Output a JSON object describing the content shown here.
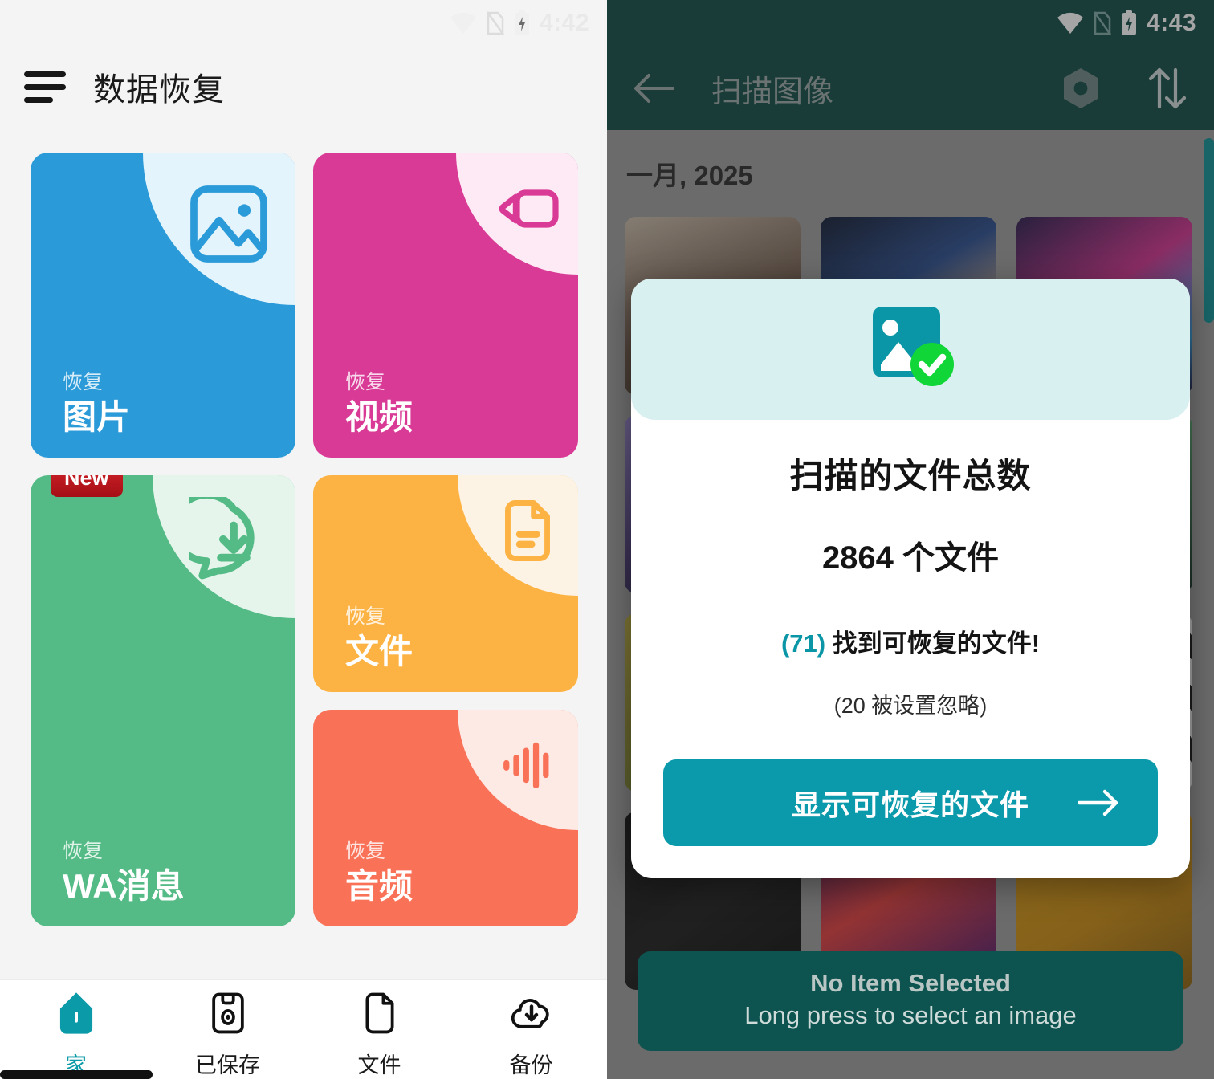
{
  "left": {
    "status": {
      "time": "4:42",
      "icons": [
        "wifi-icon",
        "sim-icon",
        "battery-charging-icon"
      ]
    },
    "appbar": {
      "menu_icon": "hamburger-menu-icon",
      "title": "数据恢复"
    },
    "tiles": [
      {
        "id": "photos",
        "small": "恢复",
        "large": "图片",
        "color": "#2b9ad8",
        "corner_bg": "#e3f4fc",
        "icon": "image-icon"
      },
      {
        "id": "videos",
        "small": "恢复",
        "large": "视频",
        "color": "#d93a96",
        "corner_bg": "#fdeaf4",
        "icon": "video-camera-icon"
      },
      {
        "id": "documents",
        "small": "恢复",
        "large": "文件",
        "color": "#fdb344",
        "corner_bg": "#fdf3e4",
        "icon": "document-icon"
      },
      {
        "id": "wa-messages",
        "small": "恢复",
        "large": "WA消息",
        "color": "#55bb86",
        "corner_bg": "#e6f5ec",
        "icon": "whatsapp-download-icon",
        "badge": "New"
      },
      {
        "id": "audio",
        "small": "恢复",
        "large": "音频",
        "color": "#f97258",
        "corner_bg": "#fdeae5",
        "icon": "audio-wave-icon"
      }
    ],
    "bottom_nav": [
      {
        "label": "家",
        "icon": "home-icon",
        "active": true
      },
      {
        "label": "已保存",
        "icon": "save-floppy-icon",
        "active": false
      },
      {
        "label": "文件",
        "icon": "file-icon",
        "active": false
      },
      {
        "label": "备份",
        "icon": "cloud-download-icon",
        "active": false
      }
    ],
    "accent": "#0a9aa8"
  },
  "right": {
    "status": {
      "time": "4:43",
      "icons": [
        "wifi-icon",
        "sim-icon",
        "battery-charging-icon"
      ]
    },
    "appbar": {
      "back_icon": "back-arrow-icon",
      "title": "扫描图像",
      "settings_icon": "hexagon-settings-icon",
      "sort_icon": "sort-arrows-icon",
      "bg": "#104a46"
    },
    "gallery": {
      "month_label": "一月, 2025"
    },
    "dialog": {
      "header_icon": "image-check-icon",
      "header_bg": "#d9f0f1",
      "title": "扫描的文件总数",
      "count": "2864 个文件",
      "found_count": "(71)",
      "found_text": "找到可恢复的文件!",
      "note": "(20 被设置忽略)",
      "button_label": "显示可恢复的文件",
      "button_arrow_icon": "arrow-right-icon",
      "button_color": "#0b9aab"
    },
    "snackbar": {
      "title": "No Item Selected",
      "subtitle": "Long press to select an image"
    }
  }
}
